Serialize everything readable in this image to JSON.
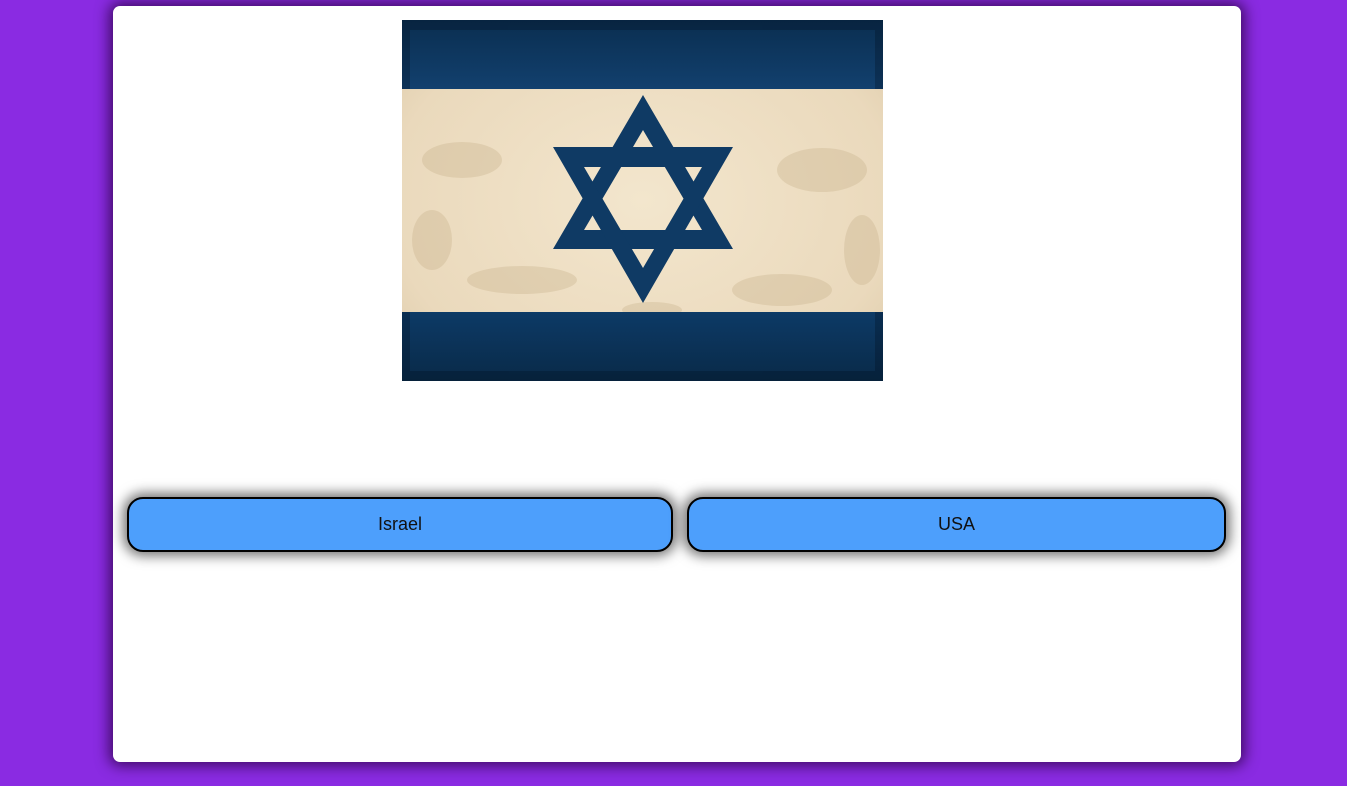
{
  "quiz": {
    "flag_icon": "israel-flag-icon",
    "colors": {
      "page_background": "#8a2be2",
      "card_background": "#ffffff",
      "button_background": "#4d9ffc",
      "flag_blue": "#0f3a64",
      "flag_field": "#eadcc0"
    },
    "answers": [
      {
        "label": "Israel"
      },
      {
        "label": "USA"
      }
    ]
  }
}
